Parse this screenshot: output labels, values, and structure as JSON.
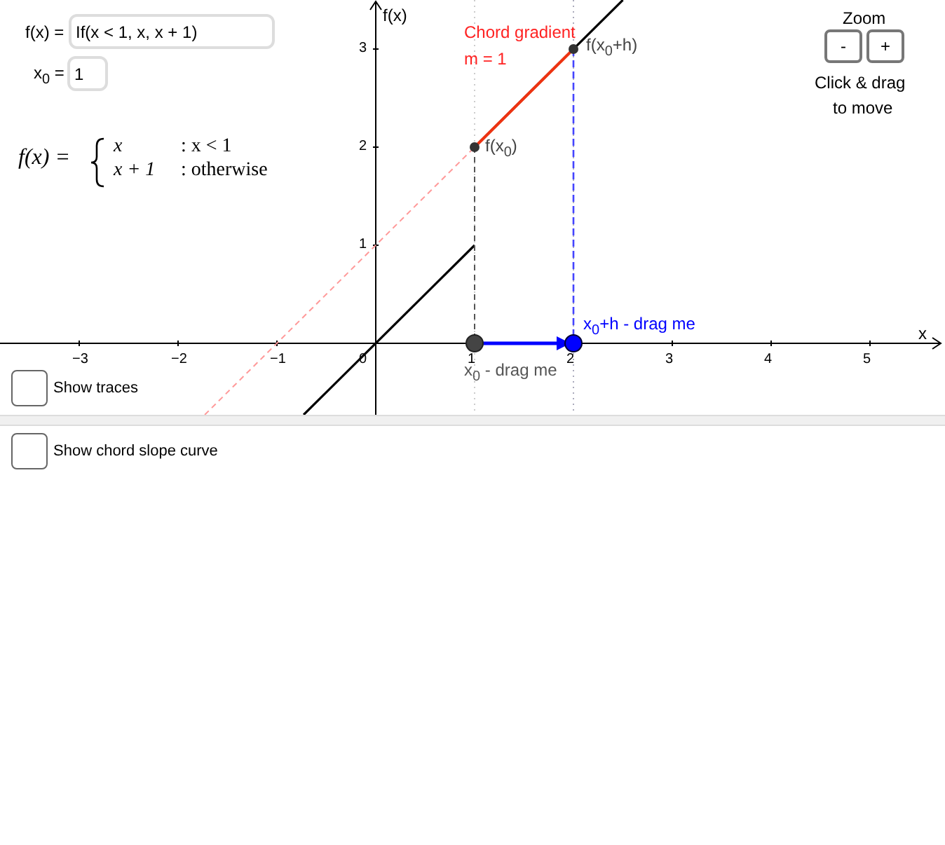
{
  "inputs": [
    {
      "label": "f(x) =",
      "value": "If(x < 1, x, x + 1)"
    },
    {
      "label": "x$_{0}$ =",
      "value": "1"
    }
  ],
  "formula": {
    "lhs": "f(x) =",
    "cases": [
      {
        "expr": "x",
        "cond": ": x < 1"
      },
      {
        "expr": "x + 1",
        "cond": ": otherwise"
      }
    ]
  },
  "graph": {
    "x_axis_label": "x",
    "y_axis_label": "f(x)",
    "x_ticks": [
      "−3",
      "−2",
      "−1",
      "0",
      "1",
      "2",
      "3",
      "4",
      "5"
    ],
    "y_ticks": [
      "3",
      "2",
      "1"
    ],
    "chord_title": "Chord gradient",
    "chord_value": "m = 1",
    "point_labels": [
      "f(x$_{0}$)",
      "f(x$_{0}$+h)"
    ],
    "handle_labels": [
      "x$_{0}$ - drag me",
      "x$_{0}$+h - drag me"
    ]
  },
  "zoom": {
    "title": "Zoom",
    "buttons": [
      "-",
      "+"
    ],
    "hint_lines": [
      "Click & drag",
      "to move"
    ]
  },
  "checkboxes": [
    {
      "label": "Show traces",
      "checked": false
    },
    {
      "label": "Show chord slope curve",
      "checked": false
    }
  ]
}
